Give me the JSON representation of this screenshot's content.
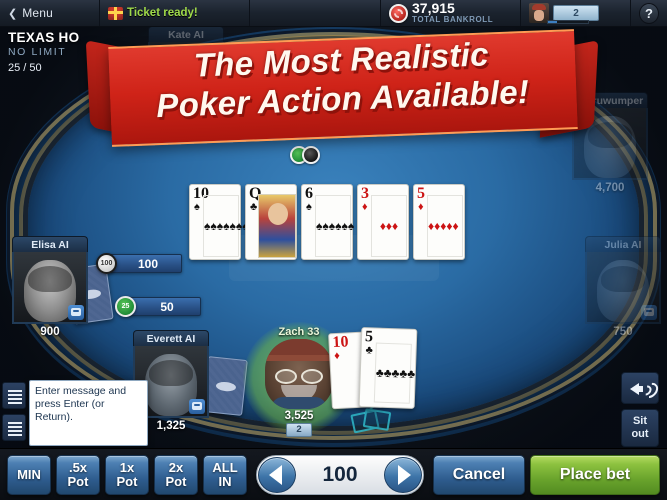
{
  "topbar": {
    "menu_label": "Menu",
    "menu_chevron": "chevron-left-icon",
    "ticket_label": "Ticket ready!",
    "bankroll_amount": "37,915",
    "bankroll_label": "TOTAL BANKROLL",
    "level_badge": "2",
    "help_label": "?"
  },
  "game_info": {
    "title": "TEXAS HO",
    "subtitle": "NO LIMIT",
    "blinds": "25 / 50"
  },
  "banner": {
    "line1": "The Most Realistic",
    "line2": "Poker Action Available!",
    "color": "#cf2318"
  },
  "board": {
    "cards": [
      {
        "rank": "10",
        "suit": "♠",
        "color": "black",
        "pips": 10
      },
      {
        "rank": "Q",
        "suit": "♣",
        "color": "black",
        "pips": 0
      },
      {
        "rank": "6",
        "suit": "♠",
        "color": "black",
        "pips": 6
      },
      {
        "rank": "3",
        "suit": "♦",
        "color": "red",
        "pips": 3
      },
      {
        "rank": "5",
        "suit": "♦",
        "color": "red",
        "pips": 5
      }
    ]
  },
  "seats": [
    {
      "name": "Kate AI",
      "stack": "",
      "state": "hidden-behind-banner"
    },
    {
      "name": "tharuwumper",
      "stack": "4,700",
      "state": "folded"
    },
    {
      "name": "Julia AI",
      "stack": "750",
      "state": "folded"
    },
    {
      "name": "Elisa AI",
      "stack": "900",
      "state": "active"
    },
    {
      "name": "Everett AI",
      "stack": "1,325",
      "state": "active"
    }
  ],
  "hero": {
    "name": "Zach 33",
    "stack": "3,525",
    "dealer_badge": "2",
    "hole_cards": [
      {
        "rank": "10",
        "suit": "♦",
        "color": "red"
      },
      {
        "rank": "5",
        "suit": "♣",
        "color": "black"
      }
    ]
  },
  "bets": [
    {
      "amount": "100",
      "chip": "white"
    },
    {
      "amount": "50",
      "chip": "green",
      "chip_value": "25"
    }
  ],
  "chat": {
    "placeholder": "Enter message and press Enter (or Return)."
  },
  "right_controls": {
    "sound_icon": "speaker-icon",
    "sit_out_line1": "Sit",
    "sit_out_line2": "out"
  },
  "bottombar": {
    "min_label": "MIN",
    "half_pot_l1": ".5x",
    "half_pot_l2": "Pot",
    "one_pot_l1": "1x",
    "one_pot_l2": "Pot",
    "two_pot_l1": "2x",
    "two_pot_l2": "Pot",
    "allin_l1": "ALL",
    "allin_l2": "IN",
    "bet_value": "100",
    "cancel_label": "Cancel",
    "place_bet_label": "Place bet",
    "place_bet_color": "#8cc13f"
  }
}
